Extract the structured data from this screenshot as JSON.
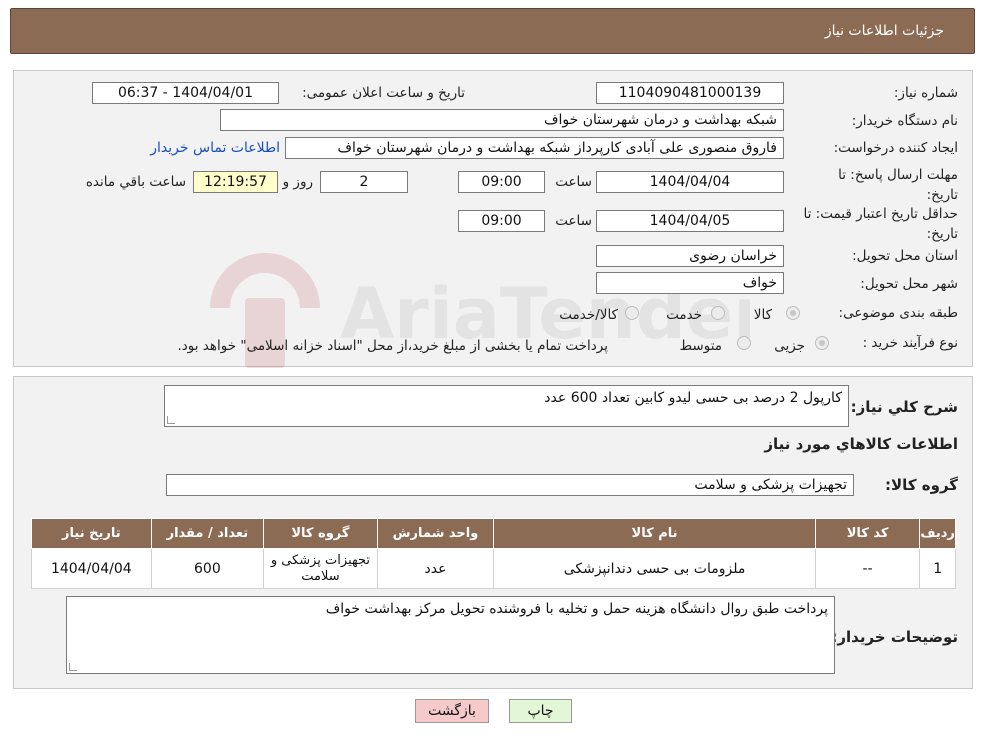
{
  "header": {
    "title": "جزئیات اطلاعات نیاز"
  },
  "labels": {
    "need_number": "شماره نیاز:",
    "announce_datetime": "تاریخ و ساعت اعلان عمومی:",
    "buyer_org": "نام دستگاه خریدار:",
    "requester": "ایجاد کننده درخواست:",
    "buyer_contact_link": "اطلاعات تماس خریدار",
    "response_deadline": "مهلت ارسال پاسخ: تا تاریخ:",
    "time": "ساعت",
    "day_and": "روز و",
    "remaining": "ساعت باقي مانده",
    "price_validity": "حداقل تاریخ اعتبار قیمت: تا تاریخ:",
    "province": "استان محل تحویل:",
    "city": "شهر محل تحویل:",
    "category": "طبقه بندی موضوعی:",
    "purchase_type": "نوع فرآیند خرید :",
    "general_description": "شرح کلي نياز:",
    "goods_info": "اطلاعات کالاهاي مورد نياز",
    "goods_group": "گروه کالا:",
    "buyer_notes": "توضیحات خریدار:"
  },
  "values": {
    "need_number": "1104090481000139",
    "announce_datetime": "1404/04/01 - 06:37",
    "buyer_org": "شبکه بهداشت و درمان شهرستان خواف",
    "requester": "فاروق منصوری علی آبادی کارپرداز شبکه بهداشت و درمان شهرستان خواف",
    "response_date": "1404/04/04",
    "response_time": "09:00",
    "remaining_days": "2",
    "remaining_time": "12:19:57",
    "price_date": "1404/04/05",
    "price_time": "09:00",
    "province": "خراسان رضوی",
    "city": "خواف",
    "general_description": "کارپول 2 درصد بی حسی لیدو کابین تعداد 600 عدد",
    "goods_group": "تجهیزات پزشکی و سلامت",
    "buyer_notes": "پرداخت طبق روال دانشگاه هزینه حمل و تخلیه با فروشنده تحویل مرکز بهداشت خواف"
  },
  "category_options": [
    {
      "label": "کالا",
      "selected": true
    },
    {
      "label": "خدمت",
      "selected": false
    },
    {
      "label": "کالا/خدمت",
      "selected": false
    }
  ],
  "purchase_options": [
    {
      "label": "جزیی",
      "selected": true
    },
    {
      "label": "متوسط",
      "selected": false
    }
  ],
  "purchase_note": "پرداخت تمام یا بخشی از مبلغ خرید،از محل \"اسناد خزانه اسلامی\" خواهد بود.",
  "table": {
    "headers": [
      "ردیف",
      "کد کالا",
      "نام کالا",
      "واحد شمارش",
      "گروه کالا",
      "تعداد / مقدار",
      "تاریخ نیاز"
    ],
    "rows": [
      [
        "1",
        "--",
        "ملزومات بی حسی دندانپزشکی",
        "عدد",
        "تجهیزات پزشکی و سلامت",
        "600",
        "1404/04/04"
      ]
    ]
  },
  "buttons": {
    "print": "چاپ",
    "back": "بازگشت"
  },
  "watermark": "AriaTender.neT",
  "colors": {
    "header": "#8c6b55",
    "back_button": "#f6caca",
    "print_button": "#e3f6d6",
    "link": "#1a4fbf"
  }
}
